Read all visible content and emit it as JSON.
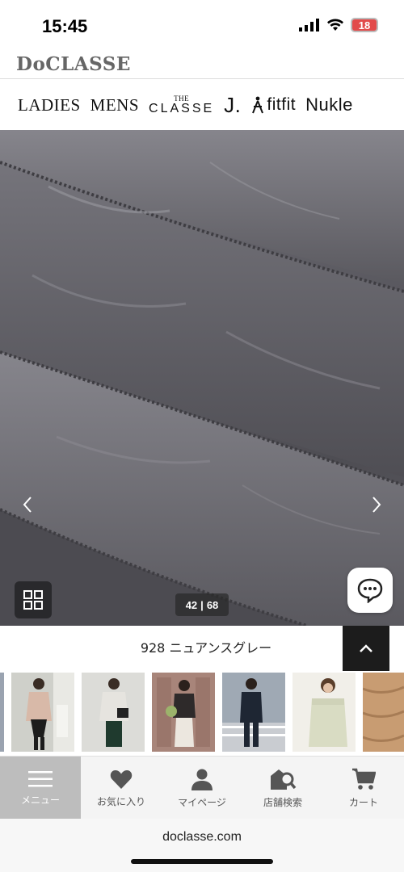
{
  "status": {
    "time": "15:45",
    "battery": "18",
    "icons": [
      "signal-icon",
      "wifi-icon",
      "battery-icon"
    ]
  },
  "header": {
    "logo": "DoCLASSE"
  },
  "brands": [
    {
      "label": "LADIES"
    },
    {
      "label": "MENS"
    },
    {
      "label_top": "THE",
      "label": "CLASSE"
    },
    {
      "label": "J."
    },
    {
      "label": "fitfit"
    },
    {
      "label": "Nukle"
    }
  ],
  "gallery": {
    "counter_current": "42",
    "counter_total": "68",
    "counter_separator": "|",
    "prev_icon": "chevron-left-icon",
    "next_icon": "chevron-right-icon"
  },
  "color": {
    "name": "928 ニュアンスグレー"
  },
  "thumbnails": [
    {
      "name": "thumb-partial"
    },
    {
      "name": "thumb-1"
    },
    {
      "name": "thumb-2"
    },
    {
      "name": "thumb-3"
    },
    {
      "name": "thumb-4"
    },
    {
      "name": "thumb-5"
    },
    {
      "name": "thumb-6"
    }
  ],
  "tabbar": {
    "items": [
      {
        "label": "メニュー",
        "icon": "menu-icon",
        "active": true
      },
      {
        "label": "お気に入り",
        "icon": "heart-icon",
        "active": false
      },
      {
        "label": "マイページ",
        "icon": "user-icon",
        "active": false
      },
      {
        "label": "店舗検索",
        "icon": "store-search-icon",
        "active": false
      },
      {
        "label": "カート",
        "icon": "cart-icon",
        "active": false
      }
    ]
  },
  "browser": {
    "url": "doclasse.com"
  },
  "colors": {
    "accent_dark": "#1c1c1c",
    "battery": "#e24a4a",
    "tab_active": "#bdbdbd",
    "fabric": "#5d5c63"
  }
}
